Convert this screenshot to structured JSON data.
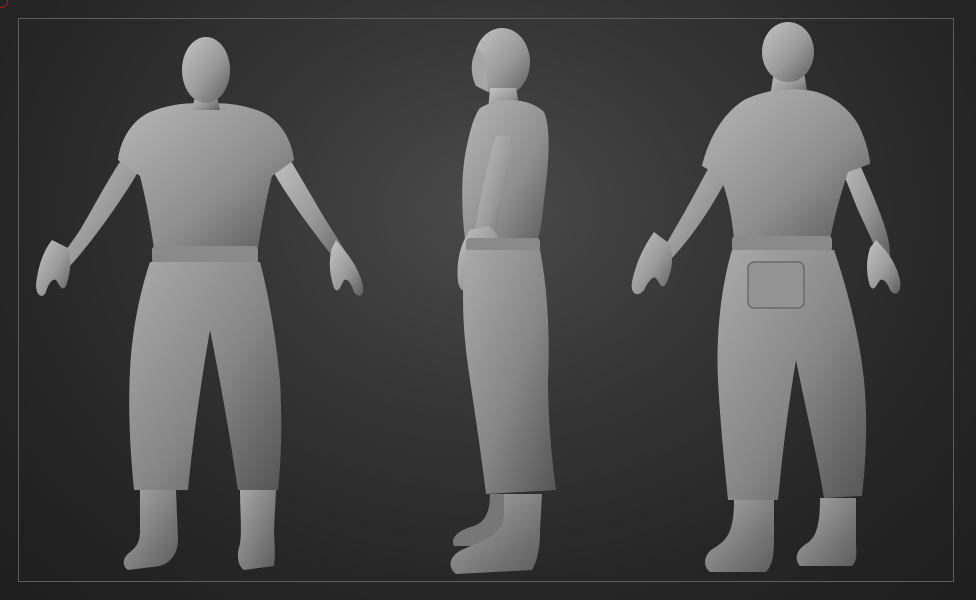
{
  "scene": {
    "views": [
      {
        "name": "front"
      },
      {
        "name": "side"
      },
      {
        "name": "back"
      }
    ],
    "colors": {
      "background_center": "#4a4a4a",
      "background_edge": "#1e1e1e",
      "frame_border": "#5e5e5e",
      "sculpt_light": "#b9b9b9",
      "sculpt_mid": "#8c8c8c",
      "sculpt_dark": "#5a5a5a",
      "corner_mark": "#b11a1a"
    }
  }
}
